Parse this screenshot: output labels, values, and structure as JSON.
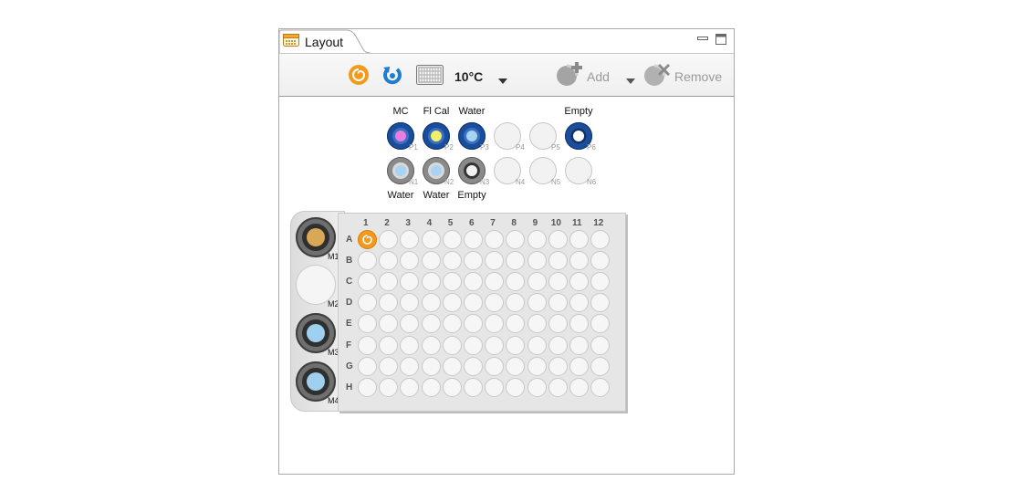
{
  "window": {
    "tab_title": "Layout",
    "tab_icon": "plate-grid-icon"
  },
  "toolbar": {
    "temperature": "10°C",
    "add_label": "Add",
    "remove_label": "Remove",
    "icons": [
      "spiral-orange-icon",
      "refresh-blue-icon",
      "plate-view-icon",
      "dropdown-arrow-icon",
      "add-icon",
      "remove-icon"
    ]
  },
  "positions_top": [
    {
      "id": "P1",
      "label": "MC",
      "state": "filled",
      "color": "#e87ee0"
    },
    {
      "id": "P2",
      "label": "Fl Cal",
      "state": "filled",
      "color": "#f1f06a"
    },
    {
      "id": "P3",
      "label": "Water",
      "state": "filled",
      "color": "#a9d3f2"
    },
    {
      "id": "P4",
      "label": "",
      "state": "empty",
      "color": ""
    },
    {
      "id": "P5",
      "label": "",
      "state": "empty",
      "color": ""
    },
    {
      "id": "P6",
      "label": "Empty",
      "state": "filled",
      "color": "#ffffff"
    }
  ],
  "positions_bottom": [
    {
      "id": "N1",
      "label": "Water",
      "state": "filled",
      "color": "#a9d3f2"
    },
    {
      "id": "N2",
      "label": "Water",
      "state": "filled",
      "color": "#a9d3f2"
    },
    {
      "id": "N3",
      "label": "Empty",
      "state": "filled",
      "color": "#ffffff"
    },
    {
      "id": "N4",
      "label": "",
      "state": "empty",
      "color": ""
    },
    {
      "id": "N5",
      "label": "",
      "state": "empty",
      "color": ""
    },
    {
      "id": "N6",
      "label": "",
      "state": "empty",
      "color": ""
    }
  ],
  "m_slots": [
    {
      "id": "M1",
      "state": "filled",
      "color": "#d8a856"
    },
    {
      "id": "M2",
      "state": "empty",
      "color": ""
    },
    {
      "id": "M3",
      "state": "filled",
      "color": "#9fd0ef"
    },
    {
      "id": "M4",
      "state": "filled",
      "color": "#9fd0ef"
    }
  ],
  "plate": {
    "columns": [
      "1",
      "2",
      "3",
      "4",
      "5",
      "6",
      "7",
      "8",
      "9",
      "10",
      "11",
      "12"
    ],
    "rows": [
      "A",
      "B",
      "C",
      "D",
      "E",
      "F",
      "G",
      "H"
    ],
    "marked_well": "A1",
    "marked_well_icon": "spiral-orange-icon"
  },
  "colors": {
    "blue_vial": "#1a4d9c",
    "gray_vial": "#8a8a8a",
    "accent_orange": "#f39a1c",
    "accent_blue": "#1f7ccf"
  }
}
